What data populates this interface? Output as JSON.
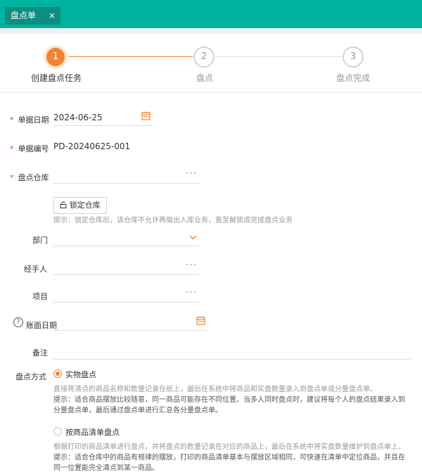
{
  "tab": {
    "label": "盘点单",
    "close": "×"
  },
  "steps": [
    {
      "number": "1",
      "label": "创建盘点任务"
    },
    {
      "number": "2",
      "label": "盘点"
    },
    {
      "number": "3",
      "label": "盘点完成"
    }
  ],
  "form": {
    "doc_date": {
      "label": "单据日期",
      "value": "2024-06-25"
    },
    "doc_no": {
      "label": "单据编号",
      "value": "PD-20240625-001"
    },
    "warehouse": {
      "label": "盘点仓库",
      "value": ""
    },
    "lock_button": "锁定仓库",
    "lock_hint": "提示：锁定仓库后，该仓库不允许再做出入库业务，直至解锁或完成盘点业务",
    "department": {
      "label": "部门",
      "value": ""
    },
    "handler": {
      "label": "经手人",
      "value": ""
    },
    "project": {
      "label": "项目",
      "value": ""
    },
    "book_date": {
      "label": "账面日期",
      "value": ""
    },
    "remark": {
      "label": "备注",
      "value": ""
    },
    "method_label": "盘点方式",
    "methods": [
      {
        "label": "实物盘点",
        "selected": true,
        "desc": "直接将清点的商品名称和数量记录在纸上，最后在系统中将商品和实盘数量录入到盘点单或分量盘点单。",
        "tip_lines": [
          "提示：适合商品摆放比较随意，同一商品可能存在不同位置。当多人同时盘点时，建议将每个人的盘点结果录入到",
          "分量盘点单，最后通过盘点单进行汇总各分量盘点单。"
        ]
      },
      {
        "label": "按商品清单盘点",
        "selected": false,
        "desc": "根据打印的商品清单进行盘点，并将盘点的数量记录在对应的商品上，最后在系统中将实盘数量维护到盘点单上。",
        "tip_lines": [
          "提示：适合仓库中的商品有规律的摆放，打印的商品清单基本与摆放区域相同，可快速在清单中定位商品，并且在",
          "同一位置能完全清点到某一商品。"
        ]
      }
    ]
  },
  "colors": {
    "header": "#00b3a1",
    "tab_active": "#0c8e80",
    "accent": "#f4822e",
    "required": "#e64340"
  },
  "icons": [
    "close-icon",
    "calendar-icon",
    "more-icon",
    "chevron-down-icon",
    "lock-icon",
    "help-icon"
  ]
}
